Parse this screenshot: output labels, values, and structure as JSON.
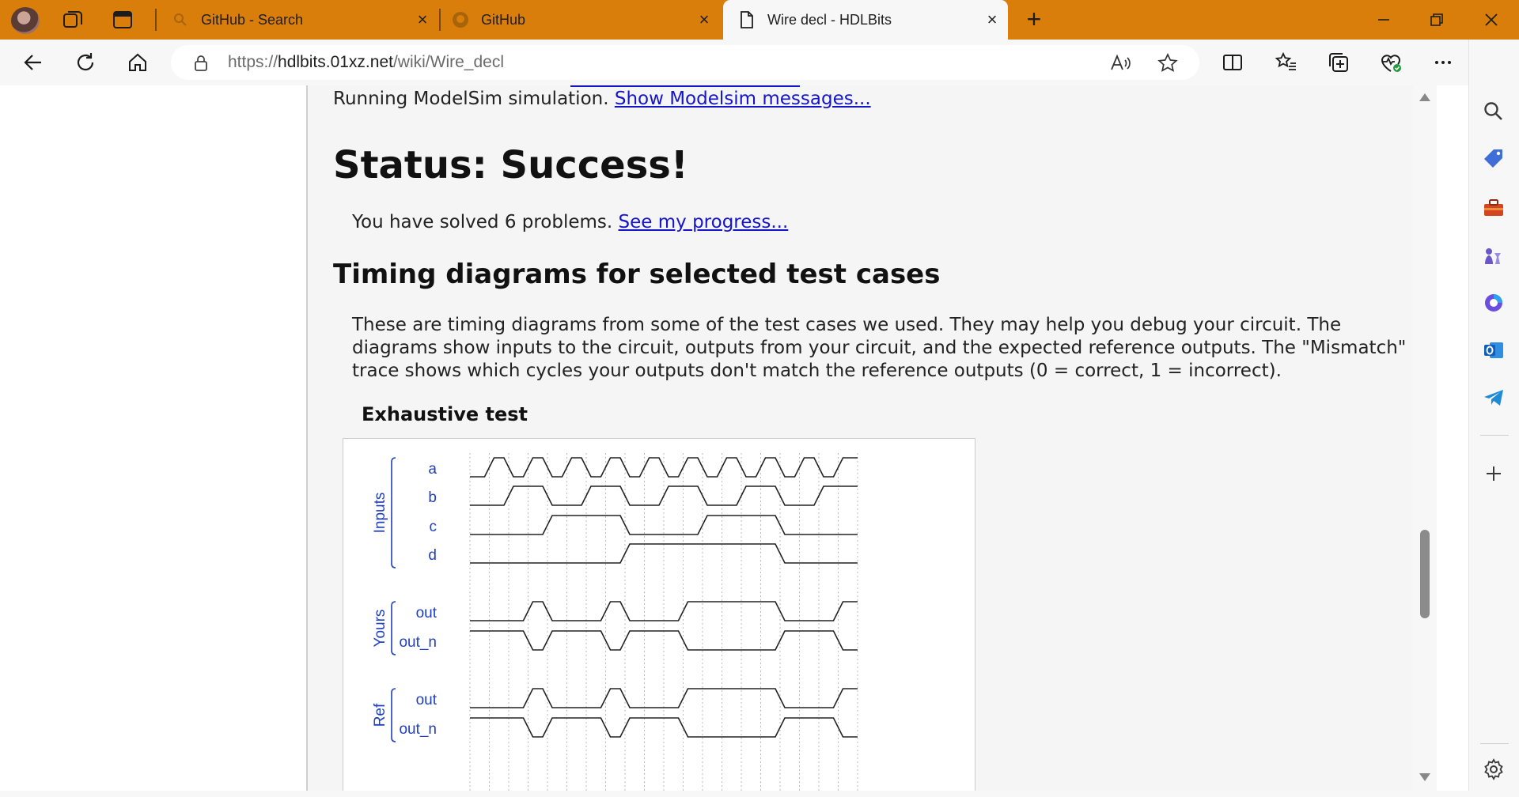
{
  "tabs": [
    {
      "title": "GitHub - Search",
      "active": false
    },
    {
      "title": "GitHub",
      "active": false
    },
    {
      "title": "Wire decl - HDLBits",
      "active": true
    }
  ],
  "address": {
    "scheme": "https://",
    "host": "hdlbits.01xz.net",
    "path": "/wiki/Wire_decl"
  },
  "page": {
    "sim_text": "Running ModelSim simulation.",
    "sim_link": "Show Modelsim messages...",
    "status_heading": "Status: Success!",
    "progress_text": "You have solved 6 problems.",
    "progress_link": "See my progress...",
    "timing_heading": "Timing diagrams for selected test cases",
    "description": "These are timing diagrams from some of the test cases we used. They may help you debug your circuit. The diagrams show inputs to the circuit, outputs from your circuit, and the expected reference outputs. The \"Mismatch\" trace shows which cycles your outputs don't match the reference outputs (0 = correct, 1 = incorrect).",
    "test_heading": "Exhaustive test"
  },
  "timing": {
    "groups": [
      {
        "label": "Inputs",
        "signals": [
          "a",
          "b",
          "c",
          "d"
        ]
      },
      {
        "label": "Yours",
        "signals": [
          "out",
          "out_n"
        ]
      },
      {
        "label": "Ref",
        "signals": [
          "out",
          "out_n"
        ]
      }
    ],
    "waves": {
      "a": [
        0,
        1,
        0,
        1,
        0,
        1,
        0,
        1,
        0,
        1,
        0,
        1,
        0,
        1,
        0,
        1,
        0,
        1,
        0,
        1
      ],
      "b": [
        0,
        0,
        1,
        1,
        0,
        0,
        1,
        1,
        0,
        0,
        1,
        1,
        0,
        0,
        1,
        1,
        0,
        0,
        1,
        1
      ],
      "c": [
        0,
        0,
        0,
        0,
        1,
        1,
        1,
        1,
        0,
        0,
        0,
        0,
        1,
        1,
        1,
        1,
        0,
        0,
        0,
        0
      ],
      "d": [
        0,
        0,
        0,
        0,
        0,
        0,
        0,
        0,
        1,
        1,
        1,
        1,
        1,
        1,
        1,
        1,
        0,
        0,
        0,
        0
      ],
      "yours_out": [
        0,
        0,
        0,
        1,
        0,
        0,
        0,
        1,
        0,
        0,
        0,
        1,
        1,
        1,
        1,
        1,
        0,
        0,
        0,
        1
      ],
      "yours_out_n": [
        1,
        1,
        1,
        0,
        1,
        1,
        1,
        0,
        1,
        1,
        1,
        0,
        0,
        0,
        0,
        0,
        1,
        1,
        1,
        0
      ],
      "ref_out": [
        0,
        0,
        0,
        1,
        0,
        0,
        0,
        1,
        0,
        0,
        0,
        1,
        1,
        1,
        1,
        1,
        0,
        0,
        0,
        1
      ],
      "ref_out_n": [
        1,
        1,
        1,
        0,
        1,
        1,
        1,
        0,
        1,
        1,
        1,
        0,
        0,
        0,
        0,
        0,
        1,
        1,
        1,
        0
      ]
    },
    "colors": {
      "label": "#1f3fbf",
      "wave": "#222222",
      "grid": "#bbbbbb"
    }
  },
  "icons": {
    "sidebar": [
      "search-icon",
      "tag-icon",
      "toolbox-icon",
      "chess-icon",
      "copilot-icon",
      "outlook-icon",
      "telegram-icon",
      "add-icon",
      "settings-icon"
    ]
  }
}
